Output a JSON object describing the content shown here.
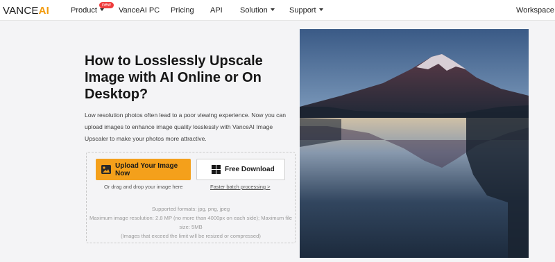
{
  "header": {
    "logo_main": "VANCE",
    "logo_accent": "AI",
    "nav": {
      "product": "Product",
      "new_badge": "new",
      "vanceai_pc": "VanceAI PC",
      "pricing": "Pricing",
      "api": "API",
      "solution": "Solution",
      "support": "Support",
      "workspace": "Workspace"
    }
  },
  "hero": {
    "title": "How to Losslessly Upscale Image with AI Online or On Desktop?",
    "description": "Low resolution photos often lead to a poor viewing experience. Now you can upload images to enhance image quality losslessly with VanceAI Image Upscaler to make your photos more attractive.",
    "upload_button": "Upload Your Image Now",
    "download_button": "Free Download",
    "drag_drop": "Or drag and drop your image here",
    "batch_link": "Faster batch processing >",
    "formats_line": "Supported formats: jpg, png, jpeg",
    "resolution_line": "Maximum image resolution: 2.8 MP (no more than 4000px on each side); Maximum file size: 5MB",
    "limit_note": "(Images that exceed the limit will be resized or compressed)"
  },
  "theme": {
    "accent": "#f4a01b",
    "brand_orange": "#f29a0b",
    "badge_red": "#ef3b3b"
  }
}
